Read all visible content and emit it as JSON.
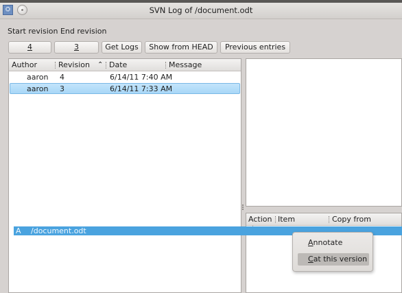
{
  "window": {
    "title": "SVN Log of /document.odt",
    "app_icon": "svn-app-icon",
    "menu_button_icon": "window-menu-icon"
  },
  "toolbar": {
    "start_revision_label": "Start revision",
    "end_revision_label": "End revision",
    "start_revision_value": "4",
    "end_revision_value": "3",
    "get_logs_label": "Get Logs",
    "show_from_head_label": "Show from HEAD",
    "previous_entries_label": "Previous entries"
  },
  "log_table": {
    "columns": [
      "Author",
      "Revision",
      "Date",
      "Message"
    ],
    "sort_icon": "sort-ascending-icon",
    "rows": [
      {
        "author": "aaron",
        "revision": "4",
        "date": "6/14/11 7:40 AM",
        "message": "",
        "selected": false
      },
      {
        "author": "aaron",
        "revision": "3",
        "date": "6/14/11 7:33 AM",
        "message": "",
        "selected": true
      }
    ]
  },
  "message_panel": {
    "text": ""
  },
  "changes_table": {
    "columns": [
      "Action",
      "Item",
      "Copy from"
    ],
    "rows": [
      {
        "action": "A",
        "item": "/document.odt",
        "copy_from": ""
      }
    ]
  },
  "context_menu": {
    "items": [
      {
        "label": "Annotate",
        "underline_index": 0,
        "highlighted": false
      },
      {
        "label": "Cat this version",
        "underline_index": 0,
        "highlighted": true
      }
    ]
  },
  "colors": {
    "selection": "#a8d7f7",
    "selection_border": "#79b8e6",
    "changes_selection": "#4aa3df"
  }
}
